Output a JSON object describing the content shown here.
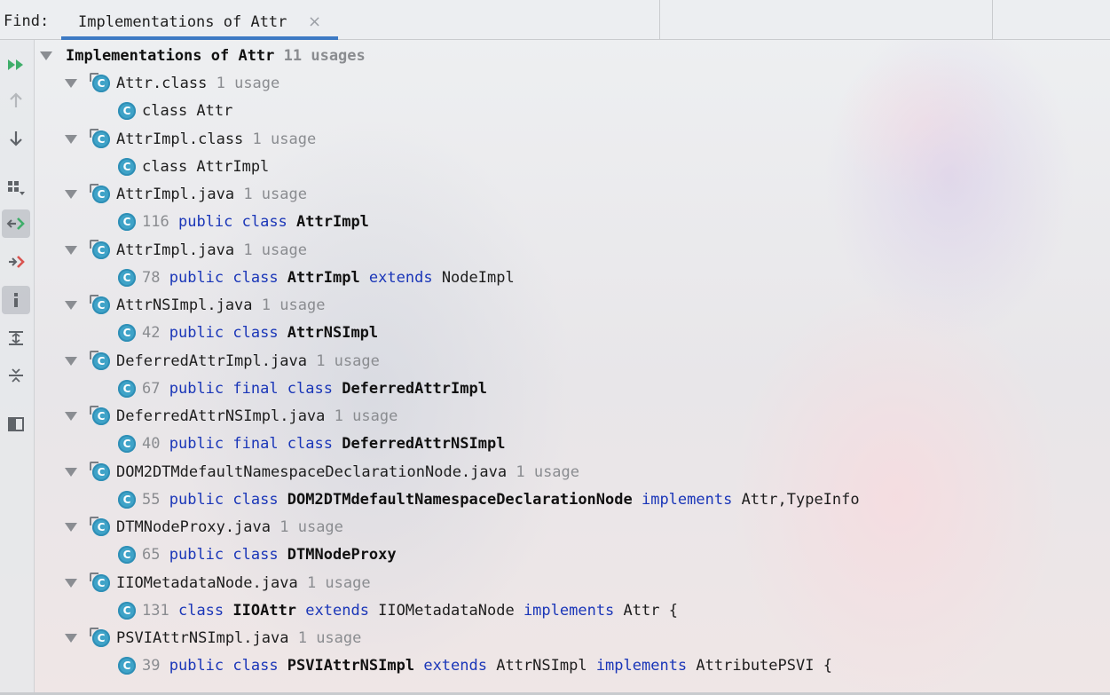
{
  "find": {
    "label": "Find:",
    "tab_title": "Implementations of Attr",
    "close_glyph": "×"
  },
  "toolbar": [
    {
      "name": "rerun-icon"
    },
    {
      "name": "previous-occurrence-icon"
    },
    {
      "name": "next-occurrence-icon"
    },
    {
      "name": "group-by-icon"
    },
    {
      "name": "navigate-with-single-click-icon"
    },
    {
      "name": "autoscroll-to-source-icon"
    },
    {
      "name": "info-icon"
    },
    {
      "name": "expand-all-icon"
    },
    {
      "name": "collapse-all-icon"
    },
    {
      "name": "preview-icon"
    }
  ],
  "tree": {
    "root": {
      "title": "Implementations of Attr",
      "count": "11 usages"
    },
    "groups": [
      {
        "file": "Attr.class",
        "count": "1 usage",
        "line": "",
        "code": [
          {
            "t": "class  Attr",
            "s": "plain"
          }
        ]
      },
      {
        "file": "AttrImpl.class",
        "count": "1 usage",
        "line": "",
        "code": [
          {
            "t": "class  AttrImpl",
            "s": "plain"
          }
        ]
      },
      {
        "file": "AttrImpl.java",
        "count": "1 usage",
        "line": "116",
        "code": [
          {
            "t": "public class ",
            "s": "kw"
          },
          {
            "t": "AttrImpl",
            "s": "bold"
          }
        ]
      },
      {
        "file": "AttrImpl.java",
        "count": "1 usage",
        "line": "78",
        "code": [
          {
            "t": "public class ",
            "s": "kw"
          },
          {
            "t": "AttrImpl ",
            "s": "bold"
          },
          {
            "t": "extends ",
            "s": "kw"
          },
          {
            "t": "NodeImpl",
            "s": "plain"
          }
        ]
      },
      {
        "file": "AttrNSImpl.java",
        "count": "1 usage",
        "line": "42",
        "code": [
          {
            "t": "public class ",
            "s": "kw"
          },
          {
            "t": "AttrNSImpl",
            "s": "bold"
          }
        ]
      },
      {
        "file": "DeferredAttrImpl.java",
        "count": "1 usage",
        "line": "67",
        "code": [
          {
            "t": "public final class ",
            "s": "kw"
          },
          {
            "t": "DeferredAttrImpl",
            "s": "bold"
          }
        ]
      },
      {
        "file": "DeferredAttrNSImpl.java",
        "count": "1 usage",
        "line": "40",
        "code": [
          {
            "t": "public final class ",
            "s": "kw"
          },
          {
            "t": "DeferredAttrNSImpl",
            "s": "bold"
          }
        ]
      },
      {
        "file": "DOM2DTMdefaultNamespaceDeclarationNode.java",
        "count": "1 usage",
        "line": "55",
        "code": [
          {
            "t": "public class ",
            "s": "kw"
          },
          {
            "t": "DOM2DTMdefaultNamespaceDeclarationNode ",
            "s": "bold"
          },
          {
            "t": "implements ",
            "s": "kw"
          },
          {
            "t": "Attr,TypeInfo",
            "s": "plain"
          }
        ]
      },
      {
        "file": "DTMNodeProxy.java",
        "count": "1 usage",
        "line": "65",
        "code": [
          {
            "t": "public class ",
            "s": "kw"
          },
          {
            "t": "DTMNodeProxy",
            "s": "bold"
          }
        ]
      },
      {
        "file": "IIOMetadataNode.java",
        "count": "1 usage",
        "line": "131",
        "code": [
          {
            "t": "class ",
            "s": "kw"
          },
          {
            "t": "IIOAttr ",
            "s": "bold"
          },
          {
            "t": "extends ",
            "s": "kw"
          },
          {
            "t": "IIOMetadataNode ",
            "s": "plain"
          },
          {
            "t": "implements ",
            "s": "kw"
          },
          {
            "t": "Attr {",
            "s": "plain"
          }
        ]
      },
      {
        "file": "PSVIAttrNSImpl.java",
        "count": "1 usage",
        "line": "39",
        "code": [
          {
            "t": "public class ",
            "s": "kw"
          },
          {
            "t": "PSVIAttrNSImpl ",
            "s": "bold"
          },
          {
            "t": "extends ",
            "s": "kw"
          },
          {
            "t": "AttrNSImpl ",
            "s": "plain"
          },
          {
            "t": "implements ",
            "s": "kw"
          },
          {
            "t": "AttributePSVI {",
            "s": "plain"
          }
        ]
      }
    ],
    "class_icon_letter": "C"
  },
  "colors": {
    "keyword": "#1a36b8",
    "class_icon": "#3fa3c8",
    "tab_underline": "#3d7ac4",
    "rerun_green": "#3fae6a"
  }
}
